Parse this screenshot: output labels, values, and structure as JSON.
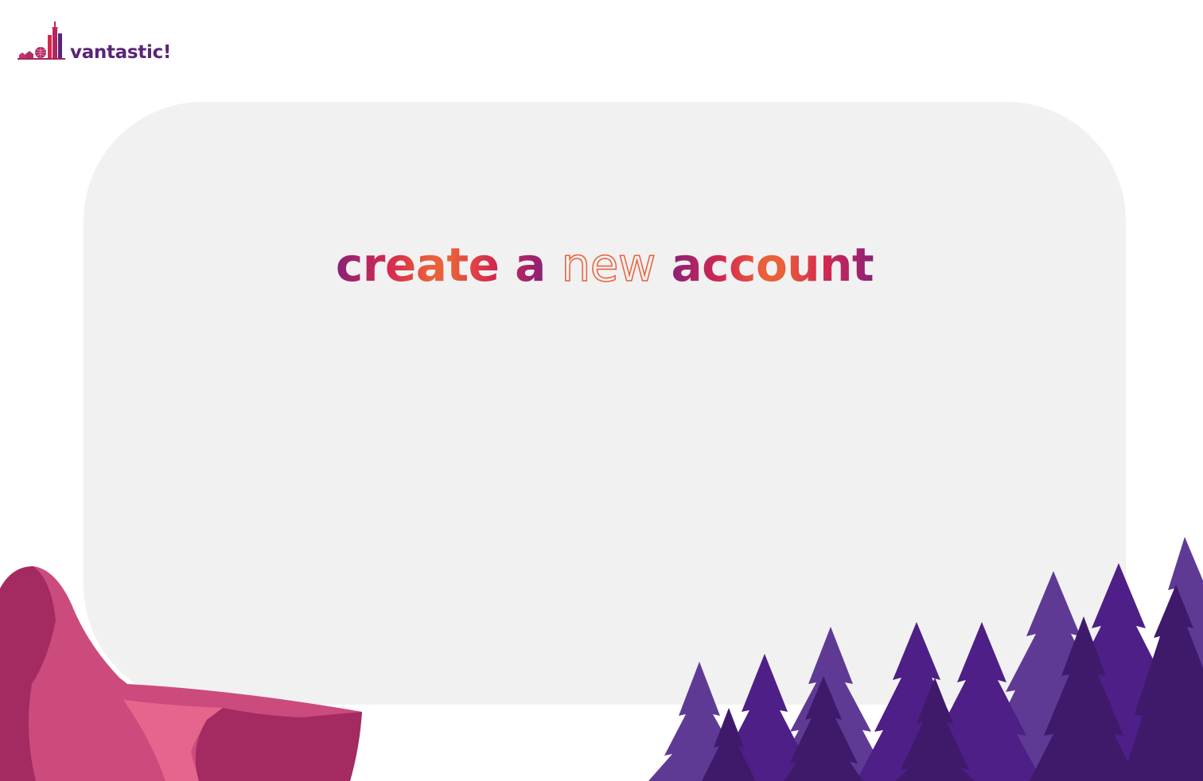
{
  "brand": {
    "name": "vantastic!",
    "logo_icon": "city-skyline-icon",
    "color": "#5a2479"
  },
  "headline": {
    "part1": "create a",
    "outlined": "new",
    "part2": "account"
  },
  "colors": {
    "gradient_purple": "#8a2178",
    "gradient_red": "#d5284f",
    "gradient_orange": "#e9603a",
    "card_background": "#f1f1f1",
    "rock_pink": "#cc4b7d",
    "tree_purple": "#5f3a95"
  },
  "decorations": {
    "left": "rock-illustration",
    "right": "pine-forest-illustration"
  }
}
